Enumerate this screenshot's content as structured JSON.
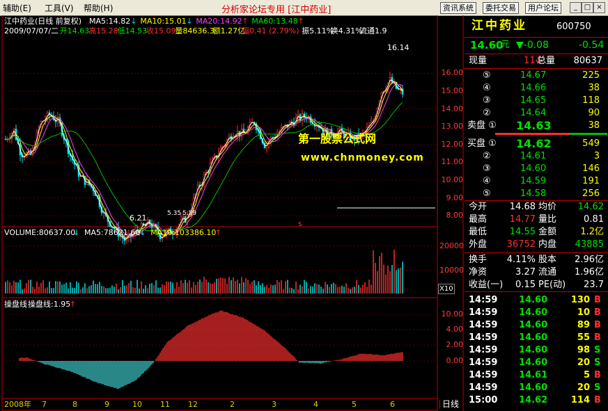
{
  "menu": {
    "items": [
      "辅助(E)",
      "工具(V)",
      "帮助(H)"
    ],
    "app_title": "分析家论坛专用 [江中药业]",
    "right_buttons": [
      "资讯系统",
      "委托交易",
      "用户论坛"
    ],
    "window_buttons": [
      "_",
      "□",
      "×"
    ]
  },
  "main": {
    "title": "江中药业(日线 前复权)",
    "ma_labels": [
      {
        "text": "MA5:14.82",
        "arrow": "↓",
        "color": "#ffffff",
        "arrow_color": "#00e0e0"
      },
      {
        "text": "MA10:15.01",
        "arrow": "↓",
        "color": "#ffff00",
        "arrow_color": "#00e0e0"
      },
      {
        "text": "MA20:14.92",
        "arrow": "↑",
        "color": "#ff40ff",
        "arrow_color": "#ff3030"
      },
      {
        "text": "MA60:13.48",
        "arrow": "↑",
        "color": "#00e000",
        "arrow_color": "#ff3030"
      }
    ],
    "quote_line": [
      {
        "text": "2009/07/07/二",
        "color": "#ffffff"
      },
      {
        "text": "开14.63",
        "color": "#00e000"
      },
      {
        "text": "高15.28",
        "color": "#ff3030"
      },
      {
        "text": "低14.53",
        "color": "#00e000"
      },
      {
        "text": "收15.09",
        "color": "#ff3030"
      },
      {
        "text": "量84636.3",
        "color": "#ffff00"
      },
      {
        "text": "额1.27亿",
        "color": "#ffff00"
      },
      {
        "text": "幅0.41 (2.79%)",
        "color": "#ff3030"
      },
      {
        "text": "振5.11%",
        "color": "#ffffff"
      },
      {
        "text": "换4.31%",
        "color": "#ffffff"
      },
      {
        "text": "流通1.9",
        "color": "#ffffff"
      }
    ],
    "y_ticks": [
      "16.00",
      "15.00",
      "14.00",
      "13.00",
      "12.00",
      "11.00",
      "10.00",
      "9.00",
      "8.00"
    ],
    "annotations": {
      "high": "16.14",
      "low": "6.21",
      "low2": "5.35",
      "low3": "5.59"
    },
    "watermark": {
      "line1": "第一股票公式网",
      "line2": "www.chnmoney.com"
    },
    "marker": "s"
  },
  "volume": {
    "labels": [
      {
        "text": "VOLUME:80637.00",
        "arrow": "↓",
        "color": "#ffffff"
      },
      {
        "text": "MA5:78621.60",
        "arrow": "↓",
        "color": "#ffffff"
      },
      {
        "text": "MA10:103386.10",
        "arrow": "↑",
        "color": "#ffff00"
      }
    ],
    "y_ticks": [
      "20000",
      "10000"
    ],
    "unit": "X10"
  },
  "indicator": {
    "labels": [
      {
        "text": "操盘线",
        "color": "#ffffff"
      },
      {
        "text": "操盘线:1.95",
        "arrow": "↑",
        "color": "#ffffff"
      }
    ],
    "y_ticks": [
      "10.00",
      "8.00",
      "6.00",
      "4.00",
      "2.00",
      "0.00"
    ]
  },
  "x_axis": {
    "labels": [
      "2008年",
      "7",
      "8",
      "9",
      "10",
      "11",
      "12",
      "2",
      "3",
      "4",
      "5",
      "6"
    ],
    "period": "日线"
  },
  "panel": {
    "name": "江中药业",
    "code": "600750",
    "price": "14.60",
    "price_unit": "元",
    "change": "▼-0.08",
    "change_pct": "-0.54",
    "now_vol_label": "现量",
    "now_vol": "114",
    "total_vol_label": "总量",
    "total_vol": "80637",
    "sell": [
      {
        "label": "⑤",
        "price": "14.67",
        "vol": "225"
      },
      {
        "label": "④",
        "price": "14.66",
        "vol": "38"
      },
      {
        "label": "③",
        "price": "14.65",
        "vol": "118"
      },
      {
        "label": "②",
        "price": "14.64",
        "vol": "90"
      },
      {
        "label": "卖盘 ①",
        "price": "14.63",
        "vol": "38"
      }
    ],
    "buy": [
      {
        "label": "买盘 ①",
        "price": "14.62",
        "vol": "549"
      },
      {
        "label": "②",
        "price": "14.61",
        "vol": "3"
      },
      {
        "label": "③",
        "price": "14.60",
        "vol": "146"
      },
      {
        "label": "④",
        "price": "14.59",
        "vol": "191"
      },
      {
        "label": "⑤",
        "price": "14.58",
        "vol": "256"
      }
    ],
    "stats": [
      [
        {
          "k": "今开",
          "v": "14.68",
          "vc": "wht"
        },
        {
          "k": "均价",
          "v": "14.62",
          "vc": "grn"
        }
      ],
      [
        {
          "k": "最高",
          "v": "14.77",
          "vc": "red"
        },
        {
          "k": "量比",
          "v": "0.81",
          "vc": "wht"
        }
      ],
      [
        {
          "k": "最低",
          "v": "14.55",
          "vc": "grn"
        },
        {
          "k": "金额",
          "v": "1.2亿",
          "vc": "yel"
        }
      ],
      [
        {
          "k": "外盘",
          "v": "36752",
          "vc": "red"
        },
        {
          "k": "内盘",
          "v": "43885",
          "vc": "grn"
        }
      ]
    ],
    "stats2": [
      [
        {
          "k": "换手",
          "v": "4.11%",
          "vc": "wht"
        },
        {
          "k": "股本",
          "v": "2.96亿",
          "vc": "wht"
        }
      ],
      [
        {
          "k": "净资",
          "v": "3.27",
          "vc": "wht"
        },
        {
          "k": "流通",
          "v": "1.96亿",
          "vc": "wht"
        }
      ],
      [
        {
          "k": "收益(一)",
          "v": "0.15",
          "vc": "wht"
        },
        {
          "k": "PE(动)",
          "v": "23.7",
          "vc": "wht"
        }
      ]
    ],
    "ticks": [
      {
        "time": "14:59",
        "price": "14.60",
        "vol": "130",
        "side": "B"
      },
      {
        "time": "14:59",
        "price": "14.60",
        "vol": "10",
        "side": "B"
      },
      {
        "time": "14:59",
        "price": "14.60",
        "vol": "89",
        "side": "B"
      },
      {
        "time": "14:59",
        "price": "14.60",
        "vol": "55",
        "side": "B"
      },
      {
        "time": "14:59",
        "price": "14.60",
        "vol": "98",
        "side": "S"
      },
      {
        "time": "14:59",
        "price": "14.60",
        "vol": "20",
        "side": "S"
      },
      {
        "time": "14:59",
        "price": "14.61",
        "vol": "5",
        "side": "B"
      },
      {
        "time": "14:59",
        "price": "14.60",
        "vol": "20",
        "side": "S"
      },
      {
        "time": "15:00",
        "price": "14.62",
        "vol": "114",
        "side": "B"
      }
    ]
  }
}
